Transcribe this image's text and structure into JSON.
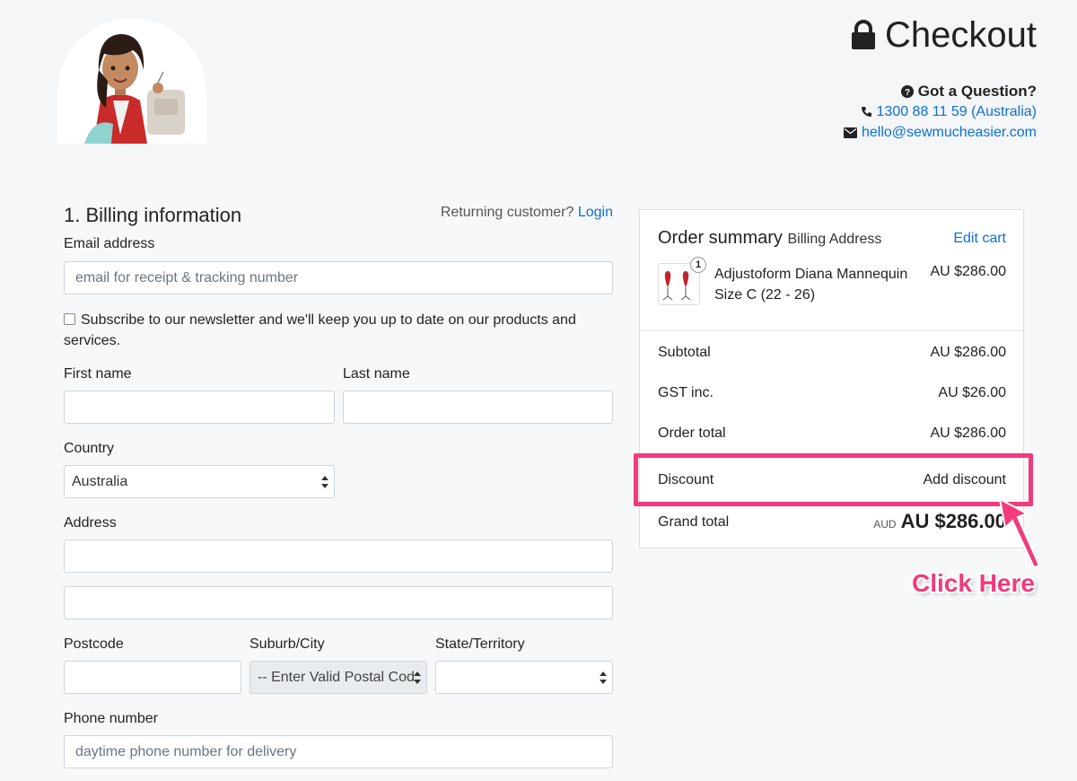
{
  "header": {
    "title": "Checkout",
    "question_title": "Got a Question?",
    "phone": "1300 88 11 59 (Australia)",
    "email": "hello@sewmucheasier.com"
  },
  "billing": {
    "title": "1. Billing information",
    "returning_text": "Returning customer?",
    "login_link": "Login",
    "email_label": "Email address",
    "email_placeholder": "email for receipt & tracking number",
    "newsletter_label": "Subscribe to our newsletter and we'll keep you up to date on our products and services.",
    "first_name_label": "First name",
    "last_name_label": "Last name",
    "country_label": "Country",
    "country_value": "Australia",
    "address_label": "Address",
    "postcode_label": "Postcode",
    "suburb_label": "Suburb/City",
    "suburb_value": "-- Enter Valid Postal Cod",
    "state_label": "State/Territory",
    "phone_label": "Phone number",
    "phone_placeholder": "daytime phone number for delivery"
  },
  "summary": {
    "title": "Order summary",
    "subtitle": "Billing Address",
    "edit_cart": "Edit cart",
    "item": {
      "name": "Adjustoform Diana Mannequin Size C (22 - 26)",
      "price": "AU $286.00",
      "qty": "1"
    },
    "rows": [
      {
        "label": "Subtotal",
        "value": "AU $286.00"
      },
      {
        "label": "GST inc.",
        "value": "AU $26.00"
      },
      {
        "label": "Order total",
        "value": "AU $286.00"
      }
    ],
    "discount_label": "Discount",
    "discount_link": "Add discount",
    "grand_label": "Grand total",
    "grand_currency": "AUD",
    "grand_value": "AU $286.00"
  },
  "annotation": {
    "text": "Click Here",
    "color": "#f23a7c"
  },
  "colors": {
    "link": "#0a6fdc",
    "background": "#f7f8f9"
  }
}
